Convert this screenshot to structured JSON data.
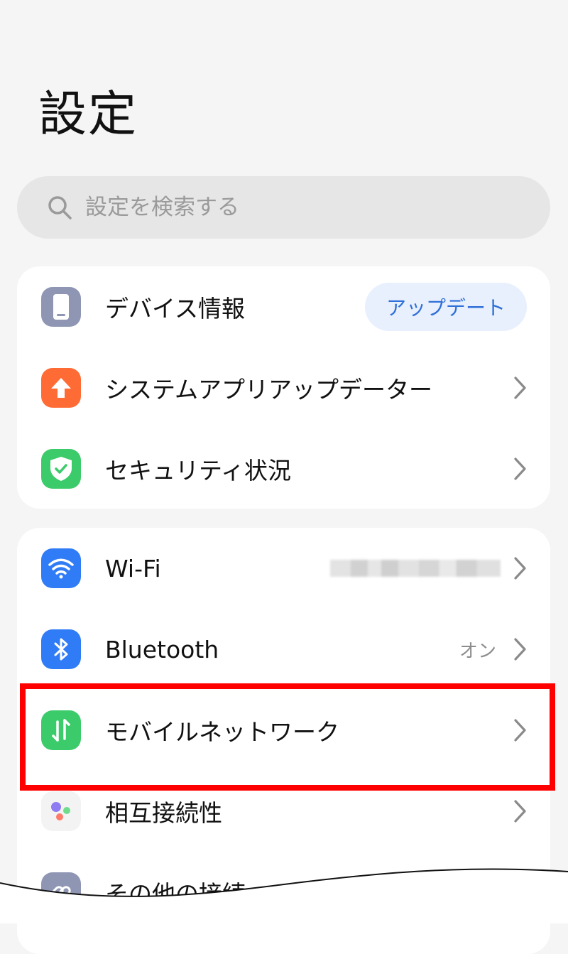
{
  "page": {
    "title": "設定"
  },
  "search": {
    "placeholder": "設定を検索する"
  },
  "group1": {
    "items": [
      {
        "label": "デバイス情報",
        "button": "アップデート",
        "icon": "phone-icon",
        "icon_color": "#8e96b4"
      },
      {
        "label": "システムアプリアップデーター",
        "icon": "arrow-up-icon",
        "icon_color": "#ff6b35"
      },
      {
        "label": "セキュリティ状況",
        "icon": "shield-check-icon",
        "icon_color": "#3ccb6a"
      }
    ]
  },
  "group2": {
    "items": [
      {
        "label": "Wi-Fi",
        "icon": "wifi-icon",
        "icon_color": "#2f7cf6"
      },
      {
        "label": "Bluetooth",
        "value": "オン",
        "icon": "bluetooth-icon",
        "icon_color": "#2f7cf6"
      },
      {
        "label": "モバイルネットワーク",
        "icon": "mobile-network-icon",
        "icon_color": "#3ccb6a"
      },
      {
        "label": "相互接続性",
        "icon": "interconnect-icon",
        "icon_color": "#f3f3f3"
      },
      {
        "label": "その他の接続",
        "icon": "link-icon",
        "icon_color": "#8e96b4"
      }
    ]
  },
  "colors": {
    "highlight": "#ff0000",
    "accent": "#2f6fd8"
  }
}
